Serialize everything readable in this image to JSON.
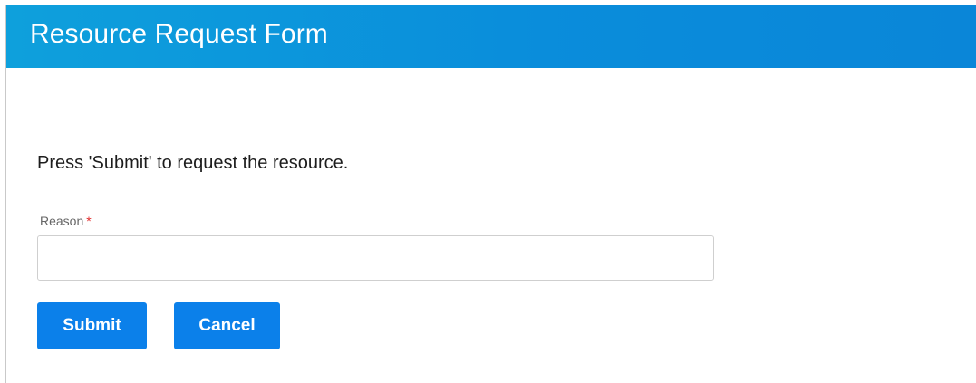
{
  "header": {
    "title": "Resource Request Form"
  },
  "form": {
    "instructions": "Press 'Submit' to request the resource.",
    "reason": {
      "label": "Reason",
      "required_marker": "*",
      "value": "",
      "placeholder": ""
    },
    "buttons": {
      "submit_label": "Submit",
      "cancel_label": "Cancel"
    }
  },
  "colors": {
    "header_start": "#0ea0dc",
    "header_end": "#0a86d8",
    "button": "#0b80ea",
    "required": "#e02b2b"
  }
}
